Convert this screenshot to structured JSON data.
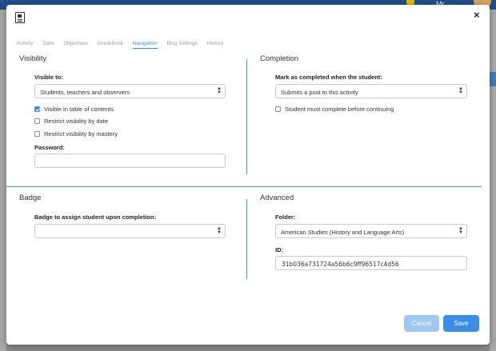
{
  "background": {
    "user_name": "Mr"
  },
  "tabs": [
    {
      "label": "Activity"
    },
    {
      "label": "Date"
    },
    {
      "label": "Objectives"
    },
    {
      "label": "Gradebook"
    },
    {
      "label": "Navigation",
      "active": true
    },
    {
      "label": "Blog Settings"
    },
    {
      "label": "History"
    }
  ],
  "close_icon": "×",
  "visibility": {
    "title": "Visibility",
    "visible_to_label": "Visible to:",
    "visible_to_value": "Students, teachers and observers",
    "checkboxes": [
      {
        "label": "Visible in table of contents",
        "checked": true
      },
      {
        "label": "Restrict visibility by date",
        "checked": false
      },
      {
        "label": "Restrict visibility by mastery",
        "checked": false
      }
    ],
    "password_label": "Password:",
    "password_value": ""
  },
  "completion": {
    "title": "Completion",
    "mark_label": "Mark as completed when the student:",
    "mark_value": "Submits a post to this activity",
    "must_complete_label": "Student must complete before continuing",
    "must_complete_checked": false
  },
  "badge": {
    "title": "Badge",
    "assign_label": "Badge to assign student upon completion:",
    "assign_value": ""
  },
  "advanced": {
    "title": "Advanced",
    "folder_label": "Folder:",
    "folder_value": "American Studies (History and Language Arts)",
    "id_label": "ID:",
    "id_value": "31b036a731724a56b6c9ff96517c4d56"
  },
  "buttons": {
    "cancel": "Cancel",
    "save": "Save"
  },
  "colors": {
    "accent": "#3a8ee6",
    "accent_light": "#9cc8f2",
    "divider": "#4a90d9"
  }
}
